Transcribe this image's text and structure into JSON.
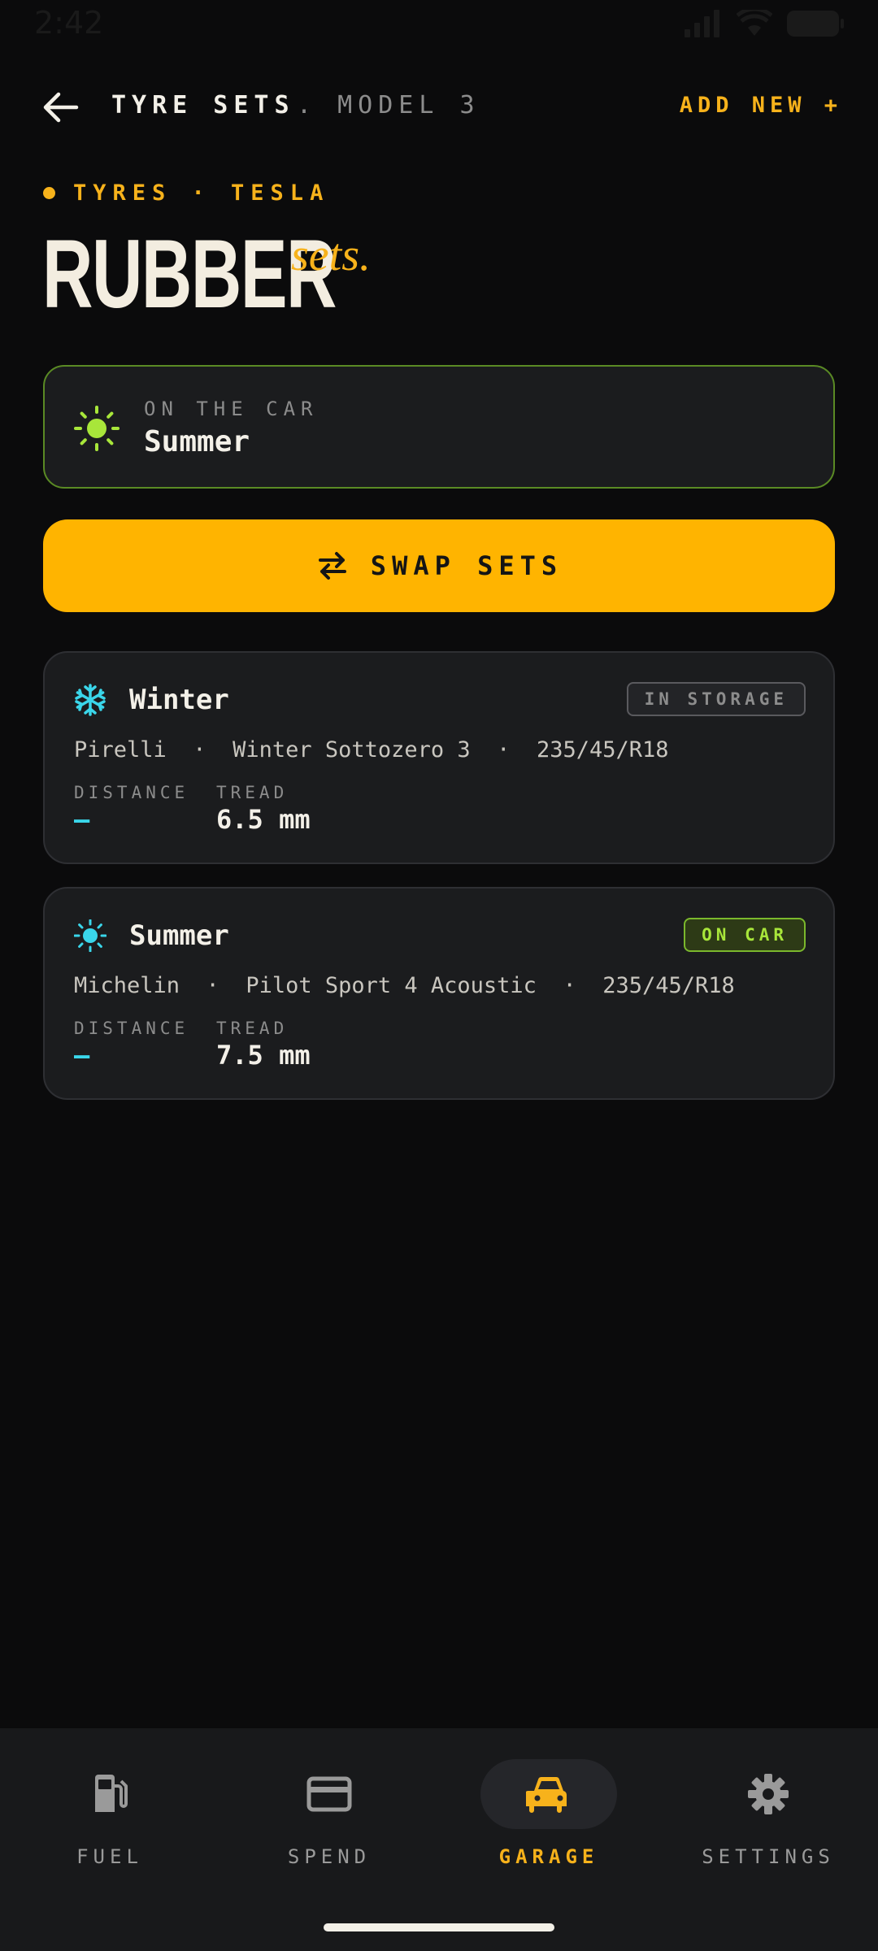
{
  "status_bar": {
    "time": "2:42"
  },
  "header": {
    "title": "TYRE SETS",
    "separator_model": ". MODEL 3",
    "add_new": "ADD NEW +"
  },
  "eyebrow": "TYRES · TESLA",
  "hero": {
    "title": "RUBBER",
    "italic": "sets."
  },
  "on_car": {
    "label": "ON THE CAR",
    "value": "Summer"
  },
  "swap_button": "SWAP SETS",
  "tyre_sets": [
    {
      "name": "Winter",
      "icon": "snowflake-icon",
      "badge": "IN STORAGE",
      "spec": "Pirelli  ·  Winter Sottozero 3  ·  235/45/R18",
      "distance_label": "DISTANCE",
      "distance_value": "—",
      "tread_label": "TREAD",
      "tread_value": "6.5 mm"
    },
    {
      "name": "Summer",
      "icon": "sun-icon",
      "badge": "ON CAR",
      "spec": "Michelin  ·  Pilot Sport 4 Acoustic  ·  235/45/R18",
      "distance_label": "DISTANCE",
      "distance_value": "—",
      "tread_label": "TREAD",
      "tread_value": "7.5 mm"
    }
  ],
  "nav": [
    {
      "label": "FUEL",
      "icon": "fuel-pump-icon"
    },
    {
      "label": "SPEND",
      "icon": "credit-card-icon"
    },
    {
      "label": "GARAGE",
      "icon": "car-icon",
      "active": true
    },
    {
      "label": "SETTINGS",
      "icon": "gear-icon"
    }
  ],
  "colors": {
    "accent": "#ffb400",
    "on_car_border": "#5a8a24",
    "dash_cyan": "#3ad6ea",
    "background": "#0b0b0c"
  }
}
